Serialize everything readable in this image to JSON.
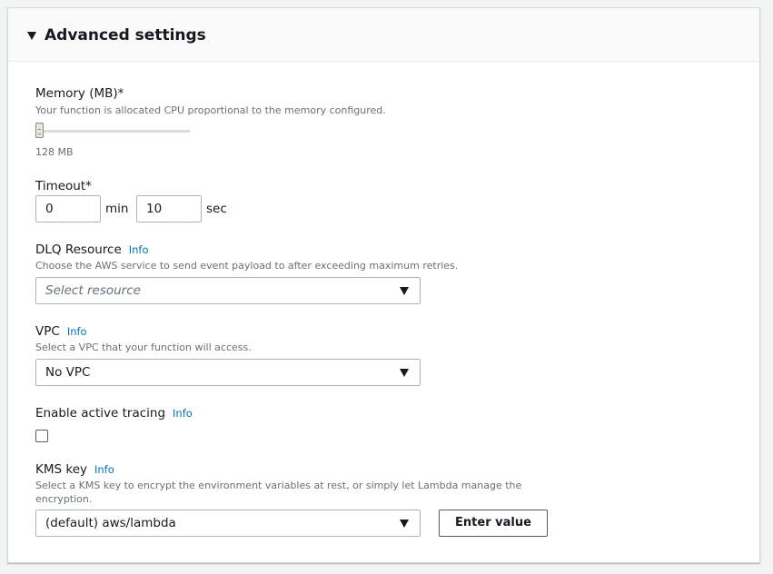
{
  "section": {
    "title": "Advanced settings"
  },
  "memory": {
    "label": "Memory (MB)*",
    "description": "Your function is allocated CPU proportional to the memory configured.",
    "value_text": "128 MB",
    "slider_fraction": 0.0
  },
  "timeout": {
    "label": "Timeout*",
    "min_value": "0",
    "min_unit": "min",
    "sec_value": "10",
    "sec_unit": "sec"
  },
  "dlq": {
    "label": "DLQ Resource",
    "info": "Info",
    "description": "Choose the AWS service to send event payload to after exceeding maximum retries.",
    "placeholder": "Select resource"
  },
  "vpc": {
    "label": "VPC",
    "info": "Info",
    "description": "Select a VPC that your function will access.",
    "selected": "No VPC"
  },
  "tracing": {
    "label": "Enable active tracing",
    "info": "Info",
    "checked": false
  },
  "kms": {
    "label": "KMS key",
    "info": "Info",
    "description": "Select a KMS key to encrypt the environment variables at rest, or simply let Lambda manage the encryption.",
    "selected": "(default) aws/lambda",
    "button_label": "Enter value"
  },
  "colors": {
    "info_link": "#0073bb",
    "page_bg": "#f2f3f3"
  }
}
